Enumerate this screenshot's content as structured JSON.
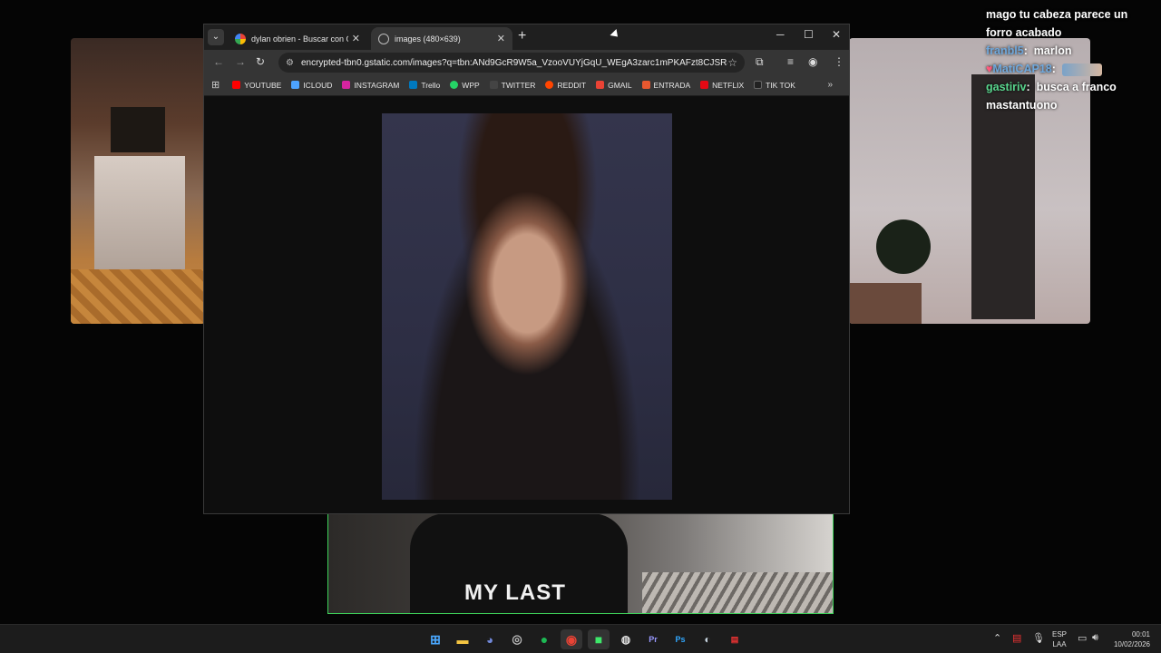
{
  "chat": {
    "lines": [
      {
        "user": "",
        "text": "mago tu cabeza parece un"
      },
      {
        "user": "",
        "text": "forro acabado"
      },
      {
        "user": "franbl5",
        "text": "marlon",
        "color": "#6fa8dc"
      },
      {
        "user": "MatiCAP18",
        "text": "",
        "color": "#6fa8dc"
      },
      {
        "user": "gastiriv",
        "text": "busca a franco",
        "color": "#58d68d"
      },
      {
        "user": "",
        "text": "mastantuono"
      }
    ]
  },
  "browser": {
    "tabs": [
      {
        "title": "dylan obrien - Buscar con Goog"
      },
      {
        "title": "images (480×639)"
      }
    ],
    "url": "encrypted-tbn0.gstatic.com/images?q=tbn:ANd9GcR9W5a_VzooVUYjGqU_WEgA3zarc1mPKAFzt8CJSR4qLxQd...",
    "bookmarks": [
      {
        "label": "YOUTUBE",
        "color": "#ff0000"
      },
      {
        "label": "ICLOUD",
        "color": "#4da3ff"
      },
      {
        "label": "INSTAGRAM",
        "color": "#d6249f"
      },
      {
        "label": "Trello",
        "color": "#0079bf"
      },
      {
        "label": "WPP",
        "color": "#25d366"
      },
      {
        "label": "TWITTER",
        "color": "#444444"
      },
      {
        "label": "REDDIT",
        "color": "#ff4500"
      },
      {
        "label": "GMAIL",
        "color": "#ea4335"
      },
      {
        "label": "ENTRADA",
        "color": "#e8582f"
      },
      {
        "label": "NETFLIX",
        "color": "#e50914"
      },
      {
        "label": "TIK TOK",
        "color": "#222222"
      }
    ]
  },
  "webcam": {
    "shirt_text": "MY LAST"
  },
  "taskbar": {
    "lang_line1": "ESP",
    "lang_line2": "LAA",
    "time": "00:01",
    "date": "10/02/2026"
  }
}
